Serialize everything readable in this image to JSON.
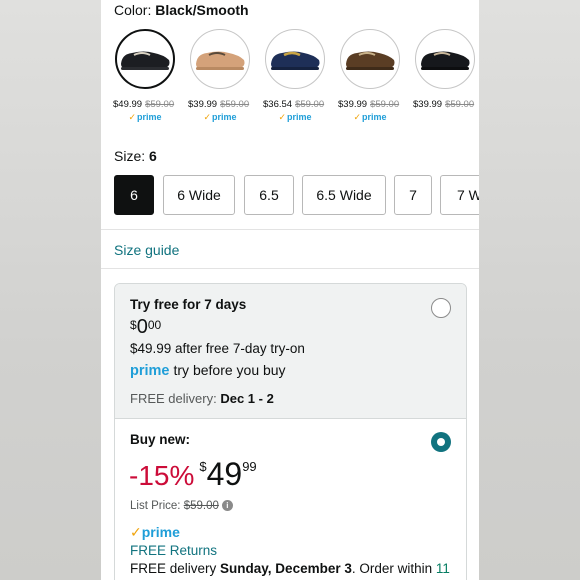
{
  "color": {
    "label": "Color:",
    "value": "Black/Smooth"
  },
  "swatches": [
    {
      "price": "$49.99",
      "old_price": "$59.00",
      "prime": "prime",
      "shoe": "#1c1e22",
      "accent": "#d9d2c2"
    },
    {
      "price": "$39.99",
      "old_price": "$59.00",
      "prime": "prime",
      "shoe": "#d4a27a",
      "accent": "#c9b49a"
    },
    {
      "price": "$36.54",
      "old_price": "$59.00",
      "prime": "prime",
      "shoe": "#1e2f57",
      "accent": "#c9a544"
    },
    {
      "price": "$39.99",
      "old_price": "$59.00",
      "prime": "prime",
      "shoe": "#5a3d24",
      "accent": "#c8b28a"
    },
    {
      "price": "$39.99",
      "old_price": "$59.00",
      "prime": "",
      "shoe": "#16181c",
      "accent": "#c9b79a"
    }
  ],
  "size": {
    "label": "Size:",
    "value": "6",
    "options": [
      "6",
      "6 Wide",
      "6.5",
      "6.5 Wide",
      "7",
      "7 W"
    ]
  },
  "size_guide": "Size guide",
  "try_offer": {
    "title": "Try free for 7 days",
    "currency": "$",
    "whole": "0",
    "cents": "00",
    "after": "$49.99 after free 7-day try-on",
    "prime_word": "prime",
    "prime_text": "try before you buy",
    "delivery_label": "FREE delivery:",
    "delivery_date": "Dec 1 - 2"
  },
  "buy_offer": {
    "title": "Buy new:",
    "discount": "-15%",
    "currency": "$",
    "whole": "49",
    "cents": "99",
    "list_label": "List Price:",
    "list_price": "$59.00",
    "prime": "prime",
    "returns": "FREE Returns",
    "delivery_prefix": "FREE delivery",
    "delivery_date": "Sunday, December 3",
    "delivery_mid": ". Order within",
    "delivery_time": "11"
  },
  "colors": {
    "link": "#11737f",
    "prime": "#1f9ed8",
    "discount": "#cc0c39",
    "selected_radio": "#11737f"
  }
}
